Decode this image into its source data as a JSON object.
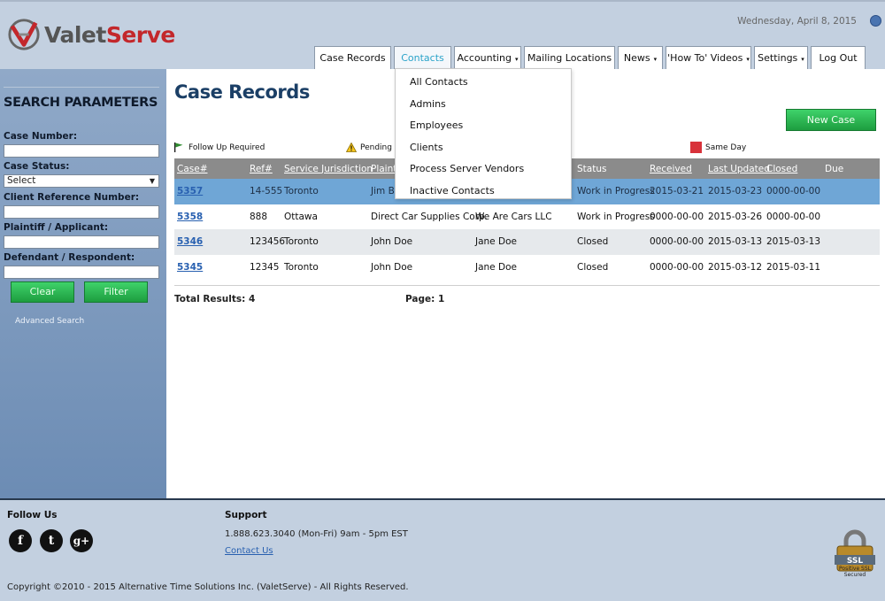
{
  "header": {
    "brand_part1": "Valet",
    "brand_part2": "Serve",
    "date": "Wednesday, April 8, 2015",
    "tabs": [
      {
        "label": "Case Records",
        "has_menu": false
      },
      {
        "label": "Contacts",
        "has_menu": false
      },
      {
        "label": "Accounting",
        "has_menu": true
      },
      {
        "label": "Mailing Locations",
        "has_menu": false
      },
      {
        "label": "News",
        "has_menu": true
      },
      {
        "label": "'How To' Videos",
        "has_menu": true
      },
      {
        "label": "Settings",
        "has_menu": true
      },
      {
        "label": "Log Out",
        "has_menu": false
      }
    ],
    "caret": "▾"
  },
  "contacts_menu": {
    "items": [
      "All Contacts",
      "Admins",
      "Employees",
      "Clients",
      "Process Server Vendors",
      "Inactive Contacts"
    ]
  },
  "sidebar": {
    "title": "SEARCH PARAMETERS",
    "case_number_label": "Case Number:",
    "case_status_label": "Case Status:",
    "case_status_value": "Select",
    "client_ref_label": "Client Reference Number:",
    "plaintiff_label": "Plaintiff / Applicant:",
    "defendant_label": "Defendant / Respondent:",
    "clear_label": "Clear",
    "filter_label": "Filter",
    "advanced_label": "Advanced Search"
  },
  "main": {
    "title": "Case Records",
    "new_case_label": "New Case",
    "legend": {
      "follow_up": "Follow Up Required",
      "pending": "Pending In",
      "same_day": "Same Day"
    },
    "columns": [
      "Case#",
      "Ref#",
      "Service Jurisdiction",
      "Plainti",
      "",
      "Status",
      "Received",
      "Last Updated",
      "Closed",
      "Due"
    ],
    "rows": [
      {
        "case": "5357",
        "ref": "14-555",
        "jurisdiction": "Toronto",
        "plaintiff": "Jim Br",
        "defendant": "",
        "status": "Work in Progress",
        "received": "2015-03-21",
        "updated": "2015-03-23",
        "closed": "0000-00-00",
        "due": ""
      },
      {
        "case": "5358",
        "ref": "888",
        "jurisdiction": "Ottawa",
        "plaintiff": "Direct Car Supplies Corp.",
        "defendant": "We Are Cars LLC",
        "status": "Work in Progress",
        "received": "0000-00-00",
        "updated": "2015-03-26",
        "closed": "0000-00-00",
        "due": ""
      },
      {
        "case": "5346",
        "ref": "123456",
        "jurisdiction": "Toronto",
        "plaintiff": "John Doe",
        "defendant": "Jane Doe",
        "status": "Closed",
        "received": "0000-00-00",
        "updated": "2015-03-13",
        "closed": "2015-03-13",
        "due": ""
      },
      {
        "case": "5345",
        "ref": "12345",
        "jurisdiction": "Toronto",
        "plaintiff": "John Doe",
        "defendant": "Jane Doe",
        "status": "Closed",
        "received": "0000-00-00",
        "updated": "2015-03-12",
        "closed": "2015-03-11",
        "due": ""
      }
    ],
    "total_results": "Total Results: 4",
    "page": "Page: 1"
  },
  "footer": {
    "follow_us": "Follow Us",
    "social": [
      {
        "icon": "facebook-icon",
        "glyph": "f"
      },
      {
        "icon": "twitter-icon",
        "glyph": "t"
      },
      {
        "icon": "google-plus-icon",
        "glyph": "g+"
      }
    ],
    "support": "Support",
    "phone": "1.888.623.3040 (Mon-Fri) 9am - 5pm EST",
    "contact_link": "Contact Us",
    "copyright": "Copyright ©2010 - 2015 Alternative Time Solutions Inc. (ValetServe) - All Rights Reserved.",
    "ssl_badge": "SSL",
    "ssl_text1": "Positive SSL",
    "ssl_text2": "Secured"
  }
}
